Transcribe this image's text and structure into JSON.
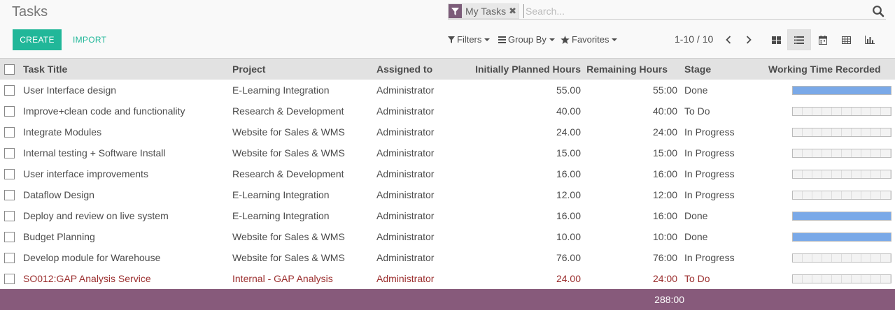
{
  "app": {
    "title": "Tasks"
  },
  "search": {
    "facet_label": "My Tasks",
    "facet_icon": "filter-icon",
    "placeholder": "Search..."
  },
  "buttons": {
    "create": "CREATE",
    "import": "IMPORT"
  },
  "filters": {
    "filters_label": "Filters",
    "groupby_label": "Group By",
    "favorites_label": "Favorites"
  },
  "pager": {
    "value": "1-10 / 10"
  },
  "views": [
    "kanban-view-icon",
    "list-view-icon",
    "calendar-view-icon",
    "pivot-view-icon",
    "graph-view-icon"
  ],
  "active_view": "list",
  "colors": {
    "accent": "#21b799",
    "brand": "#875a7b",
    "progress": "#7aa9e8",
    "late": "#9b2e2e"
  },
  "table": {
    "headers": [
      "Task Title",
      "Project",
      "Assigned to",
      "Initially Planned Hours",
      "Remaining Hours",
      "Stage",
      "Working Time Recorded"
    ],
    "rows": [
      {
        "title": "User Interface design",
        "project": "E-Learning Integration",
        "assigned": "Administrator",
        "planned": "55.00",
        "remaining": "55:00",
        "stage": "Done",
        "progress": 1,
        "late": false
      },
      {
        "title": "Improve+clean code and functionality",
        "project": "Research & Development",
        "assigned": "Administrator",
        "planned": "40.00",
        "remaining": "40:00",
        "stage": "To Do",
        "progress": 0,
        "late": false
      },
      {
        "title": "Integrate Modules",
        "project": "Website for Sales & WMS",
        "assigned": "Administrator",
        "planned": "24.00",
        "remaining": "24:00",
        "stage": "In Progress",
        "progress": 0,
        "late": false
      },
      {
        "title": "Internal testing + Software Install",
        "project": "Website for Sales & WMS",
        "assigned": "Administrator",
        "planned": "15.00",
        "remaining": "15:00",
        "stage": "In Progress",
        "progress": 0,
        "late": false
      },
      {
        "title": "User interface improvements",
        "project": "Research & Development",
        "assigned": "Administrator",
        "planned": "16.00",
        "remaining": "16:00",
        "stage": "In Progress",
        "progress": 0,
        "late": false
      },
      {
        "title": "Dataflow Design",
        "project": "E-Learning Integration",
        "assigned": "Administrator",
        "planned": "12.00",
        "remaining": "12:00",
        "stage": "In Progress",
        "progress": 0,
        "late": false
      },
      {
        "title": "Deploy and review on live system",
        "project": "E-Learning Integration",
        "assigned": "Administrator",
        "planned": "16.00",
        "remaining": "16:00",
        "stage": "Done",
        "progress": 1,
        "late": false
      },
      {
        "title": "Budget Planning",
        "project": "Website for Sales & WMS",
        "assigned": "Administrator",
        "planned": "10.00",
        "remaining": "10:00",
        "stage": "Done",
        "progress": 1,
        "late": false
      },
      {
        "title": "Develop module for Warehouse",
        "project": "Website for Sales & WMS",
        "assigned": "Administrator",
        "planned": "76.00",
        "remaining": "76:00",
        "stage": "In Progress",
        "progress": 0,
        "late": false
      },
      {
        "title": "SO012:GAP Analysis Service",
        "project": "Internal - GAP Analysis",
        "assigned": "Administrator",
        "planned": "24.00",
        "remaining": "24:00",
        "stage": "To Do",
        "progress": 0,
        "late": true
      }
    ],
    "total_remaining": "288:00"
  }
}
